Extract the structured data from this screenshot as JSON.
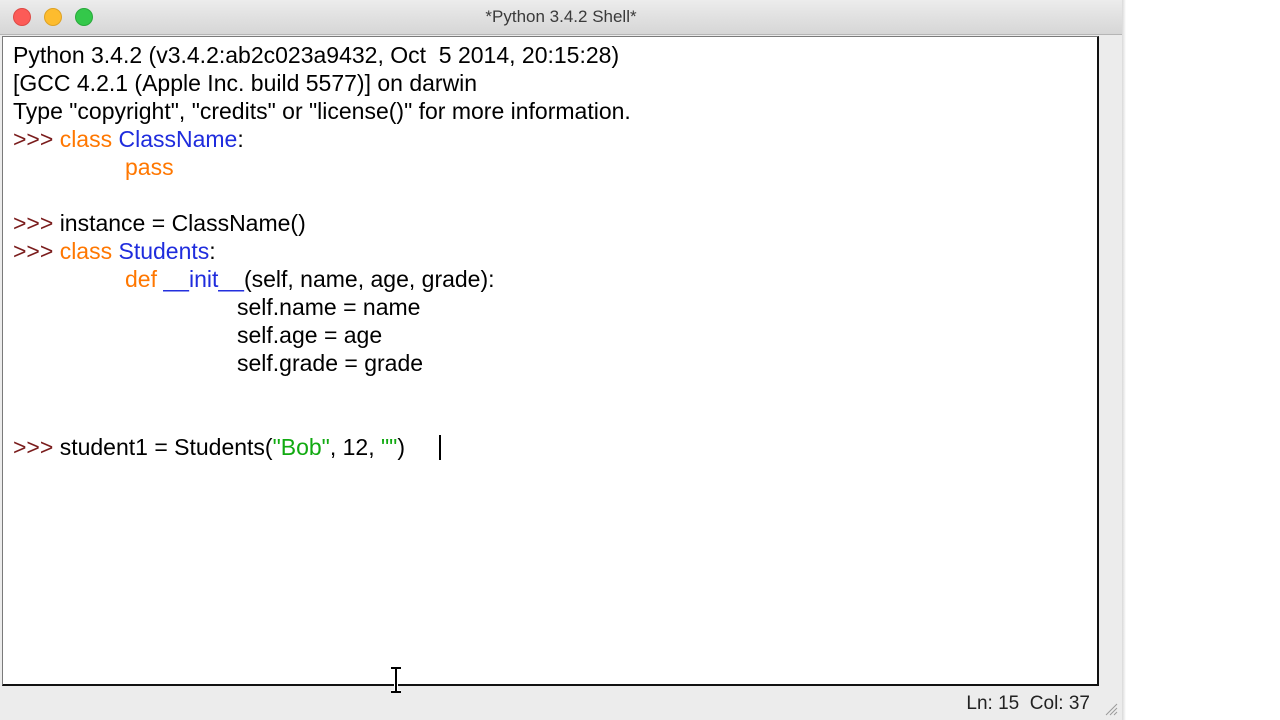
{
  "window": {
    "title": "*Python 3.4.2 Shell*"
  },
  "shell": {
    "banner": [
      "Python 3.4.2 (v3.4.2:ab2c023a9432, Oct  5 2014, 20:15:28)",
      "[GCC 4.2.1 (Apple Inc. build 5577)] on darwin",
      "Type \"copyright\", \"credits\" or \"license()\" for more information."
    ],
    "prompt": ">>> ",
    "code": {
      "kw_class": "class",
      "classname": "ClassName",
      "colon": ":",
      "kw_pass": "pass",
      "instance_line": "instance = ClassName()",
      "students": "Students",
      "kw_def": "def",
      "init_name": "__init__",
      "init_params": "(self, name, age, grade):",
      "assign_name": "self.name = name",
      "assign_age": "self.age = age",
      "assign_grade": "self.grade = grade",
      "student_prefix": "student1 = Students(",
      "str_bob": "\"Bob\"",
      "mid_args": ", 12, ",
      "str_empty": "\"\"",
      "close_paren": ")"
    }
  },
  "status": {
    "text": "Ln: 15  Col: 37"
  },
  "colors": {
    "prompt": "#7a1c1c",
    "keyword": "#ff7700",
    "definition": "#1f2cdd",
    "string": "#11aa11"
  },
  "icons": [
    "close-window-icon",
    "minimize-window-icon",
    "zoom-window-icon",
    "resize-grip-icon",
    "text-cursor-icon"
  ]
}
